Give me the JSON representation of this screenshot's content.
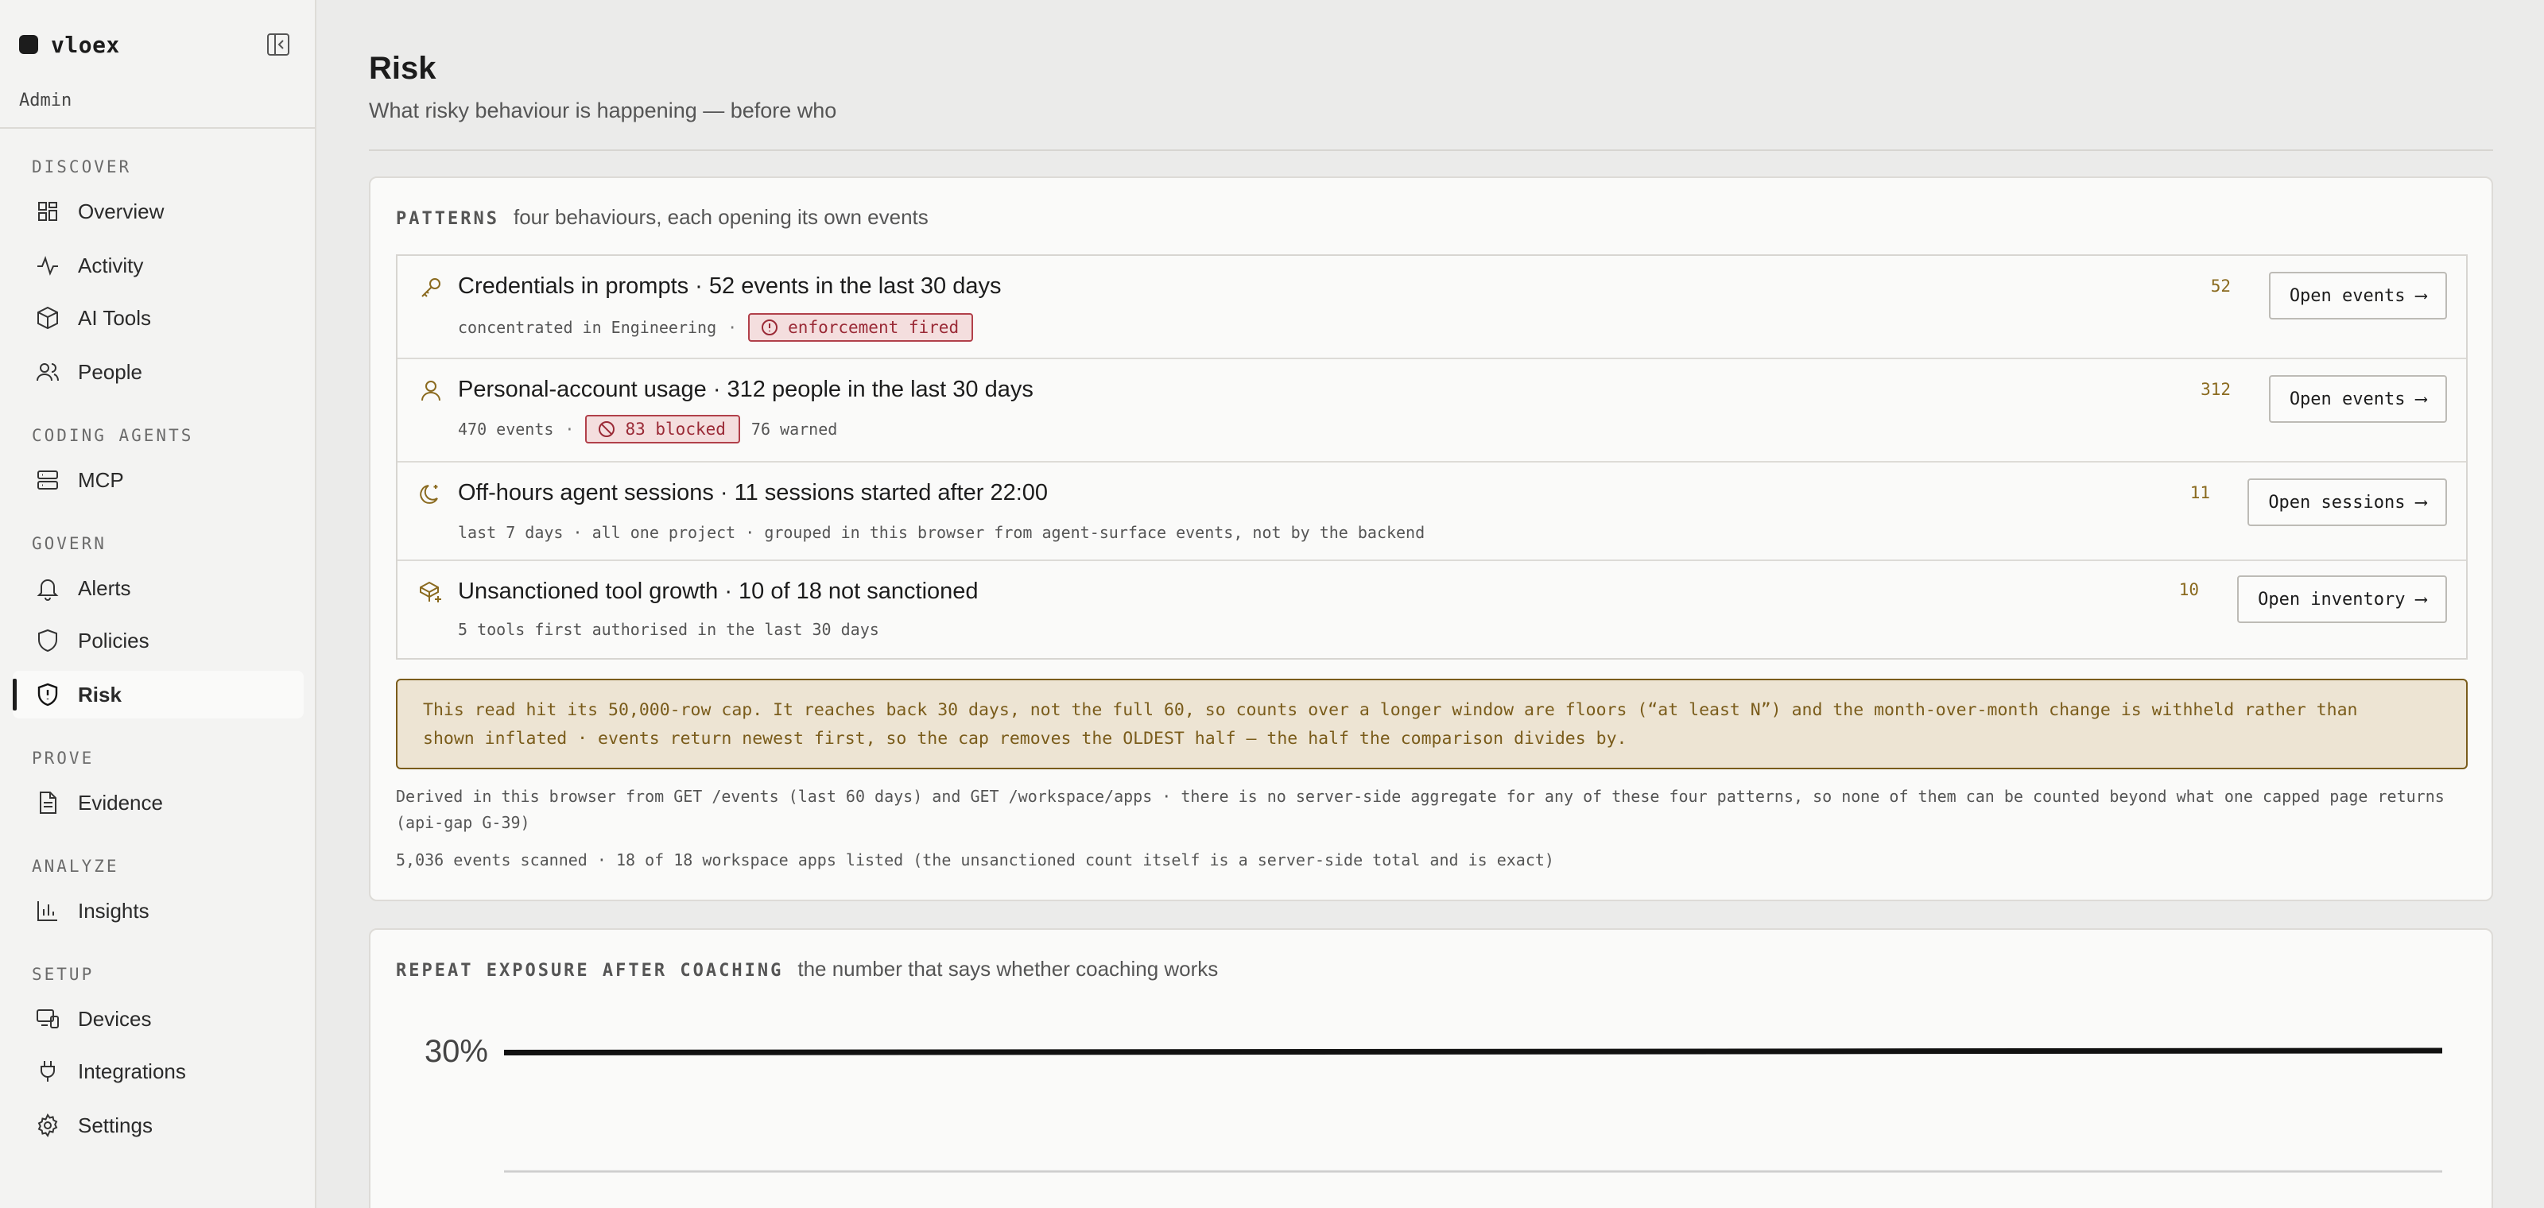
{
  "app": {
    "name": "vloex",
    "role": "Admin"
  },
  "sidebar": {
    "sections": [
      {
        "label": "DISCOVER",
        "items": [
          {
            "label": "Overview",
            "icon": "grid-icon"
          },
          {
            "label": "Activity",
            "icon": "activity-icon"
          },
          {
            "label": "AI Tools",
            "icon": "box-icon"
          },
          {
            "label": "People",
            "icon": "users-icon"
          }
        ]
      },
      {
        "label": "CODING AGENTS",
        "items": [
          {
            "label": "MCP",
            "icon": "server-icon"
          }
        ]
      },
      {
        "label": "GOVERN",
        "items": [
          {
            "label": "Alerts",
            "icon": "bell-icon"
          },
          {
            "label": "Policies",
            "icon": "shield-icon"
          },
          {
            "label": "Risk",
            "icon": "shield-alert-icon",
            "active": true
          }
        ]
      },
      {
        "label": "PROVE",
        "items": [
          {
            "label": "Evidence",
            "icon": "file-icon"
          }
        ]
      },
      {
        "label": "ANALYZE",
        "items": [
          {
            "label": "Insights",
            "icon": "bar-chart-icon"
          }
        ]
      },
      {
        "label": "SETUP",
        "items": [
          {
            "label": "Devices",
            "icon": "devices-icon"
          },
          {
            "label": "Integrations",
            "icon": "plug-icon"
          },
          {
            "label": "Settings",
            "icon": "gear-icon"
          }
        ]
      }
    ]
  },
  "page": {
    "title": "Risk",
    "subtitle": "What risky behaviour is happening — before who"
  },
  "patterns_card": {
    "heading": "PATTERNS",
    "description": "four behaviours, each opening its own events",
    "rows": [
      {
        "icon": "key-icon",
        "title": "Credentials in prompts · 52 events in the last 30 days",
        "meta_text": "concentrated in Engineering",
        "badge": "enforcement fired",
        "count": "52",
        "button": "Open events ⟶"
      },
      {
        "icon": "user-icon",
        "title": "Personal-account usage · 312 people in the last 30 days",
        "meta_text": "470 events",
        "badge": "83 blocked",
        "meta_after": "76 warned",
        "count": "312",
        "button": "Open events ⟶"
      },
      {
        "icon": "moon-icon",
        "title": "Off-hours agent sessions · 11 sessions started after 22:00",
        "meta_text": "last 7 days · all one project · grouped in this browser from agent-surface events, not by the backend",
        "count": "11",
        "button": "Open sessions ⟶"
      },
      {
        "icon": "package-plus-icon",
        "title": "Unsanctioned tool growth · 10 of 18 not sanctioned",
        "meta_text": "5 tools first authorised in the last 30 days",
        "count": "10",
        "button": "Open inventory ⟶"
      }
    ],
    "warning_line1": "This read hit its 50,000-row cap. It reaches back 30 days, not the full 60, so counts over a longer window are floors (“at least N”) and the month-over-month change is withheld rather than",
    "warning_line2": "shown inflated · events return newest first, so the cap removes the OLDEST half — the half the comparison divides by.",
    "derived_note": "Derived in this browser from GET /events (last 60 days) and GET /workspace/apps · there is no server-side aggregate for any of these four patterns, so none of them can be counted beyond what one capped page returns (api-gap G-39)",
    "scan_note": "5,036 events scanned · 18 of 18 workspace apps listed (the unsanctioned count itself is a server-side total and is exact)"
  },
  "repeat_card": {
    "heading": "REPEAT EXPOSURE AFTER COACHING",
    "description": "the number that says whether coaching works"
  },
  "chart_data": {
    "type": "line",
    "y_ticks": [
      "30%"
    ],
    "series": [
      {
        "values": [
          29.5,
          30.0
        ]
      }
    ],
    "ylim": [
      0,
      30
    ],
    "grid": true,
    "colors": {
      "line": "#111111",
      "grid": "#cfcfcf"
    }
  },
  "colors": {
    "accent": "#8a6a1f",
    "danger": "#b1404a",
    "warning_bg": "#ede4d3"
  }
}
